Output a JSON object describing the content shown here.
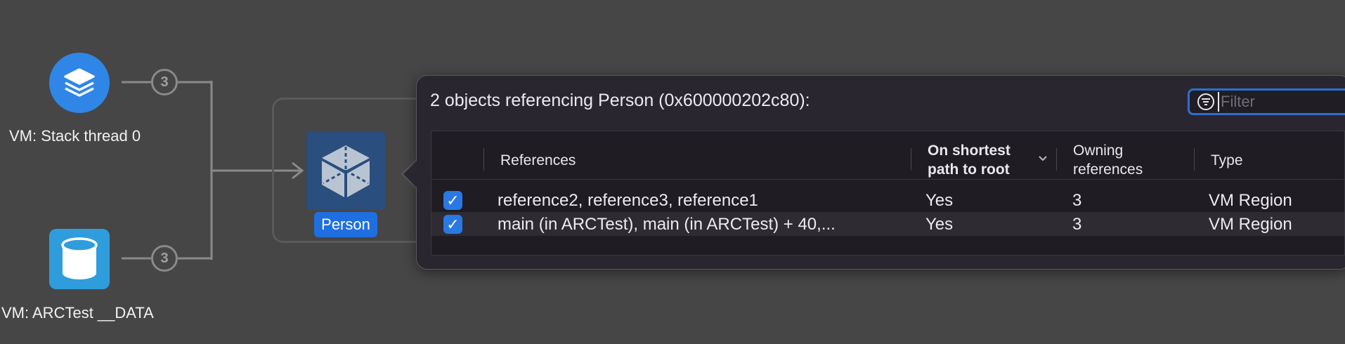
{
  "graph": {
    "nodes": [
      {
        "label": "VM: Stack thread 0",
        "icon": "stack-layers-icon",
        "badge": "3"
      },
      {
        "label": "VM: ARCTest __DATA",
        "icon": "database-cylinder-icon",
        "badge": "3"
      }
    ],
    "target": {
      "label": "Person",
      "icon": "cube-object-icon"
    }
  },
  "popover": {
    "title": "2 objects referencing Person (0x600000202c80):",
    "filter": {
      "placeholder": "Filter",
      "value": ""
    },
    "columns": {
      "references": "References",
      "shortest_line1": "On shortest",
      "shortest_line2": "path to root",
      "owning_line1": "Owning",
      "owning_line2": "references",
      "type": "Type"
    },
    "rows": [
      {
        "checked": true,
        "references": "reference2, reference3, reference1",
        "shortest": "Yes",
        "owning": "3",
        "type": "VM Region"
      },
      {
        "checked": true,
        "references": "main (in ARCTest), main (in ARCTest) + 40,...",
        "shortest": "Yes",
        "owning": "3",
        "type": "VM Region"
      }
    ]
  },
  "colors": {
    "background": "#464646",
    "accent": "#1f6fe0",
    "popover": "#2a2630"
  }
}
